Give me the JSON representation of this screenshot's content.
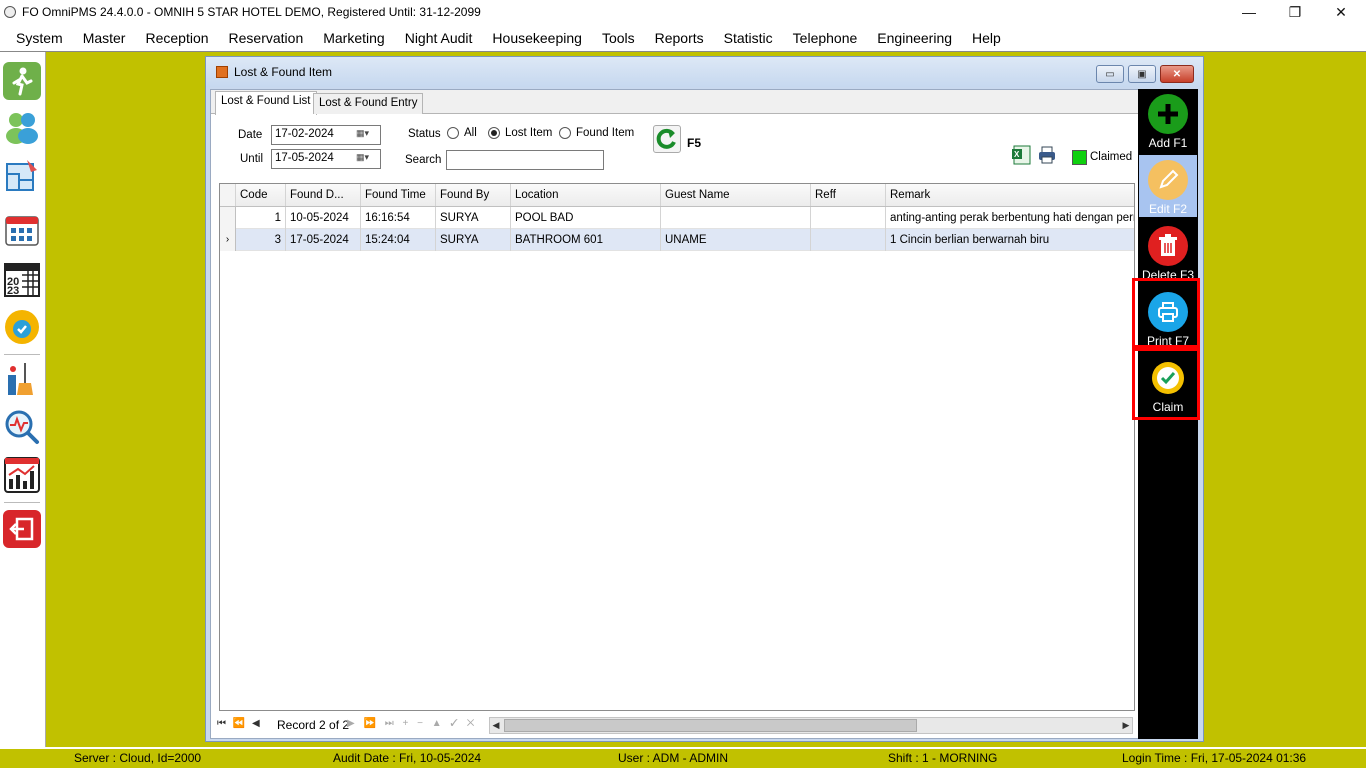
{
  "window": {
    "title": "FO OmniPMS 24.4.0.0 - OMNIH 5 STAR HOTEL DEMO, Registered Until: 31-12-2099",
    "minimize_glyph": "—",
    "restore_glyph": "❐",
    "close_glyph": "✕"
  },
  "menu": [
    "System",
    "Master",
    "Reception",
    "Reservation",
    "Marketing",
    "Night Audit",
    "Housekeeping",
    "Tools",
    "Reports",
    "Statistic",
    "Telephone",
    "Engineering",
    "Help"
  ],
  "left_toolbar": [
    {
      "icon": "walk-in-icon"
    },
    {
      "icon": "guest-profile-icon"
    },
    {
      "icon": "floor-plan-icon"
    },
    {
      "icon": "room-availability-icon"
    },
    {
      "icon": "calendar-icon"
    },
    {
      "icon": "guarantee-badge-icon"
    },
    {
      "icon": "housekeeping-icon"
    },
    {
      "icon": "analysis-search-icon"
    },
    {
      "icon": "statistics-chart-icon"
    },
    {
      "icon": "exit-icon"
    }
  ],
  "child": {
    "title": "Lost & Found Item",
    "tabs": [
      "Lost & Found List",
      "Lost & Found Entry"
    ],
    "filter": {
      "date_label": "Date",
      "date_value": "17-02-2024",
      "until_label": "Until",
      "until_value": "17-05-2024",
      "status_label": "Status",
      "status_options": [
        "All",
        "Lost Item",
        "Found Item"
      ],
      "status_selected": "Lost Item",
      "search_label": "Search",
      "search_value": "",
      "refresh_label": "F5",
      "claimed_label": "Claimed",
      "claimed_color": "#0fd00f"
    },
    "grid": {
      "columns": [
        "Code",
        "Found D...",
        "Found Time",
        "Found By",
        "Location",
        "Guest Name",
        "Reff",
        "Remark"
      ],
      "rows": [
        {
          "code": "1",
          "found_date": "10-05-2024",
          "found_time": "16:16:54",
          "found_by": "SURYA",
          "location": "POOL BAD",
          "guest_name": "",
          "reff": "",
          "remark": "anting-anting perak berbentung hati dengan perma",
          "selected": false
        },
        {
          "code": "3",
          "found_date": "17-05-2024",
          "found_time": "15:24:04",
          "found_by": "SURYA",
          "location": "BATHROOM 601",
          "guest_name": "UNAME",
          "reff": "",
          "remark": "1 Cincin berlian berwarnah biru",
          "selected": true
        }
      ],
      "selected_indicator": "›",
      "record_text": "Record 2 of 2",
      "nav_left": "⏮ ⏪ ◀",
      "nav_right": "▶ ⏩ ⏭ + − ▲ ✓ ✕"
    },
    "actions": [
      {
        "label": "Add F1",
        "icon": "add-icon",
        "color": "#1a9c1a",
        "enabled": true
      },
      {
        "label": "Edit F2",
        "icon": "edit-icon",
        "color": "#f5b342",
        "enabled": false
      },
      {
        "label": "Delete F3",
        "icon": "delete-icon",
        "color": "#e02020",
        "enabled": true
      },
      {
        "label": "Print F7",
        "icon": "print-icon",
        "color": "#1aa5e8",
        "enabled": true
      },
      {
        "label": "Claim",
        "icon": "claim-icon",
        "color": "#f4c000",
        "enabled": true
      }
    ]
  },
  "status_bar": {
    "server": "Server : Cloud, Id=2000",
    "audit_date": "Audit Date : Fri, 10-05-2024",
    "user": "User : ADM - ADMIN",
    "shift": "Shift : 1 - MORNING",
    "login_time": "Login Time : Fri, 17-05-2024 01:36"
  },
  "colors": {
    "workspace": "#c1c100",
    "action_panel": "#000000",
    "highlight": "#ff0000"
  }
}
